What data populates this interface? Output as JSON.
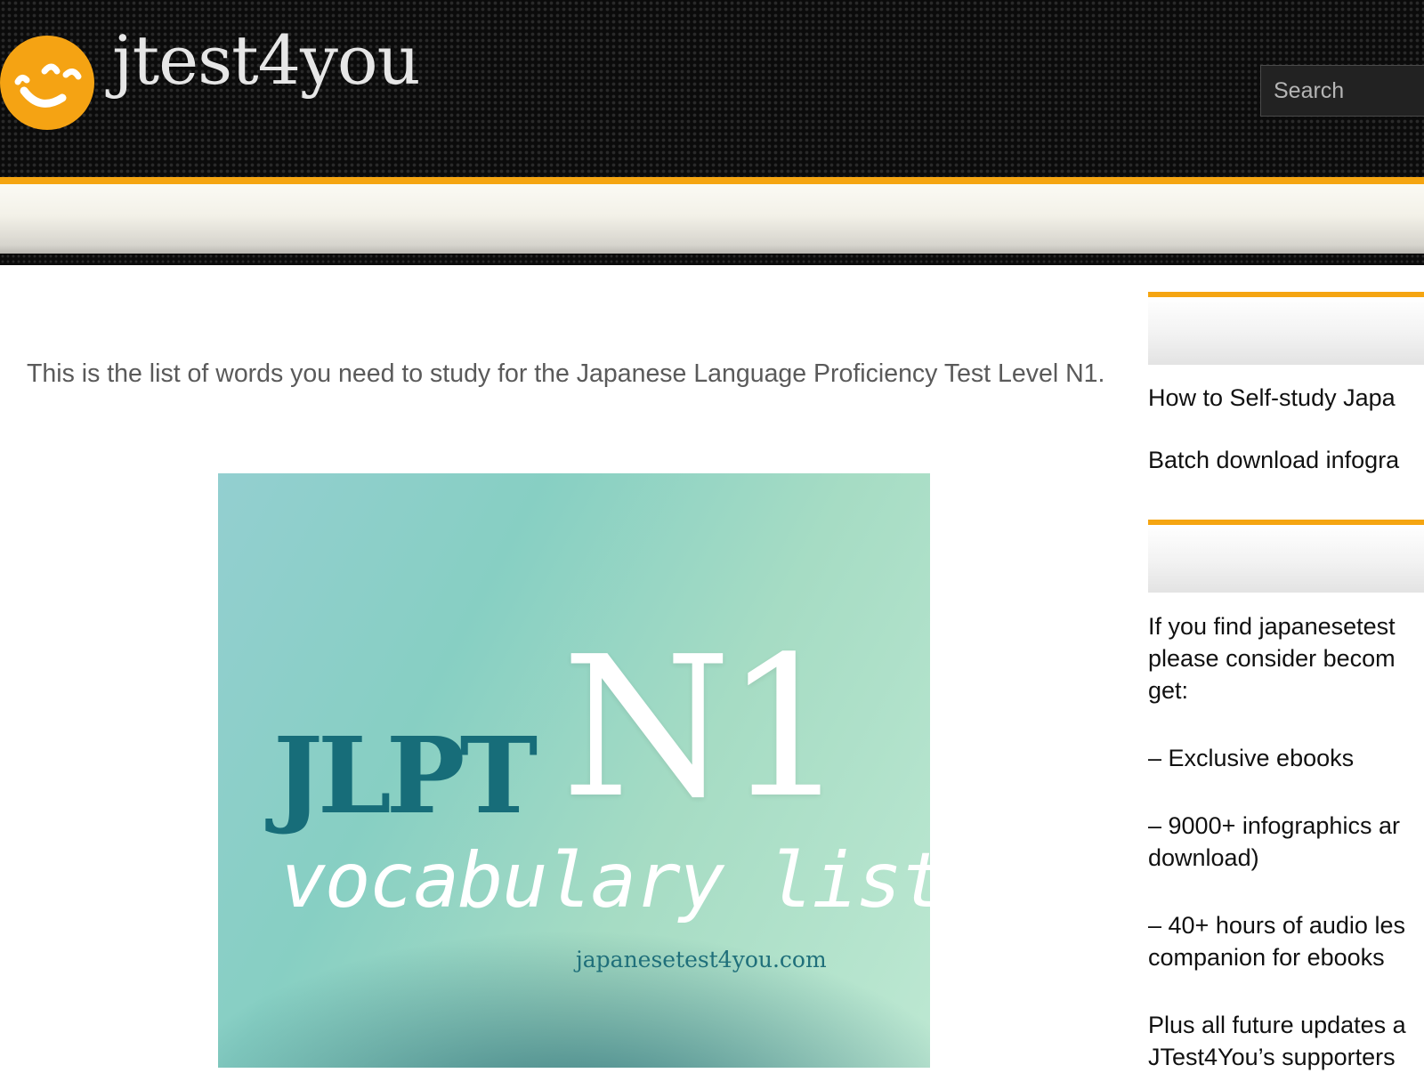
{
  "header": {
    "logo_text": "jtest4you",
    "search_placeholder": "Search"
  },
  "main": {
    "intro_text": "This is the list of words you need to study for the Japanese Language Proficiency Test Level N1.",
    "banner": {
      "prefix": "JLPT",
      "level": "N1",
      "subtitle": "vocabulary list",
      "site": "japanesetest4you.com"
    }
  },
  "sidebar": {
    "links": [
      "How to Self-study Japa",
      "Batch download infogra"
    ],
    "support": {
      "para_lines": [
        "If you find japanesetest",
        "please consider becom",
        "get:"
      ],
      "items": [
        [
          "– Exclusive ebooks"
        ],
        [
          "– 9000+ infographics ar",
          "download)"
        ],
        [
          "– 40+ hours of audio les",
          "companion for ebooks"
        ]
      ],
      "footer_lines": [
        "Plus all future updates a",
        "JTest4You’s supporters"
      ]
    }
  },
  "colors": {
    "accent": "#f5a511",
    "header_bg": "#0b0b0b",
    "banner_dark_text": "#176d79"
  }
}
